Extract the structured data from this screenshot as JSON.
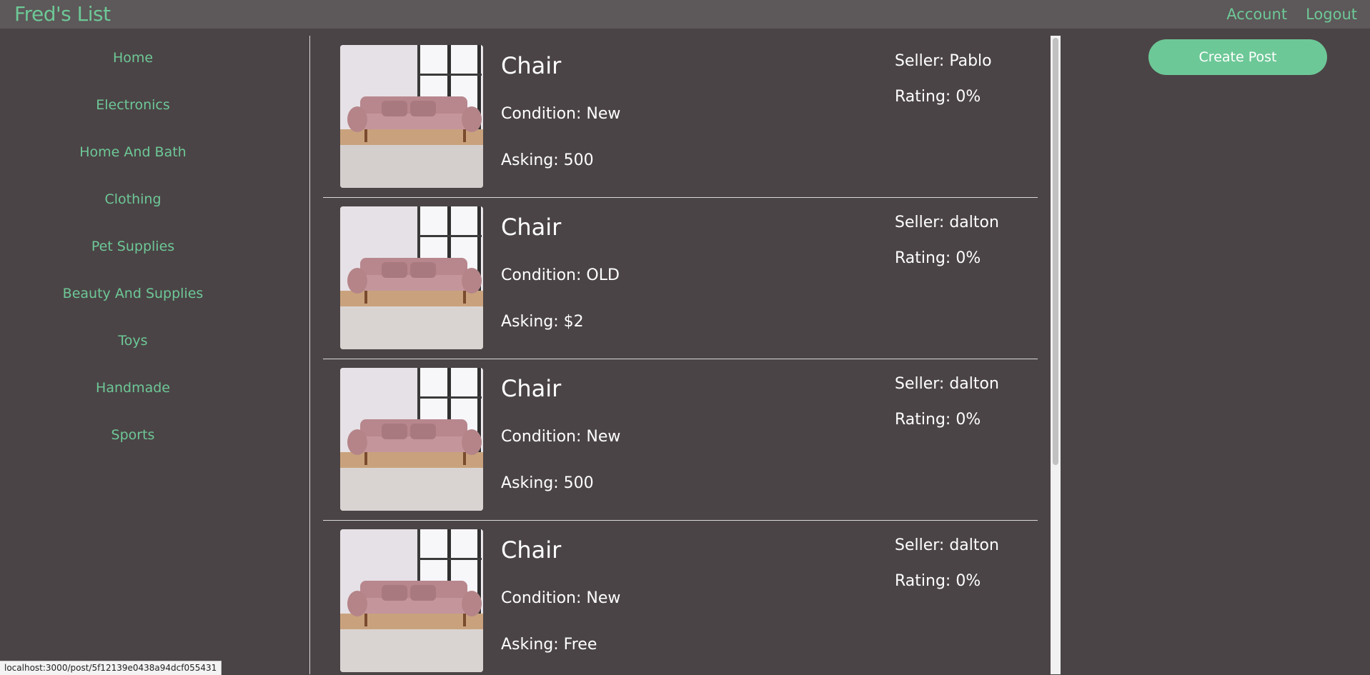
{
  "header": {
    "brand": "Fred's List",
    "nav": [
      "Account",
      "Logout"
    ]
  },
  "sidebar": {
    "items": [
      "Home",
      "Electronics",
      "Home And Bath",
      "Clothing",
      "Pet Supplies",
      "Beauty And Supplies",
      "Toys",
      "Handmade",
      "Sports"
    ]
  },
  "actions": {
    "create_post": "Create Post"
  },
  "posts": [
    {
      "title": "Chair",
      "condition": "Condition: New",
      "asking": "Asking: 500",
      "seller": "Seller: Pablo",
      "rating": "Rating: 0%"
    },
    {
      "title": "Chair",
      "condition": "Condition: OLD",
      "asking": "Asking: $2",
      "seller": "Seller: dalton",
      "rating": "Rating: 0%"
    },
    {
      "title": "Chair",
      "condition": "Condition: New",
      "asking": "Asking: 500",
      "seller": "Seller: dalton",
      "rating": "Rating: 0%"
    },
    {
      "title": "Chair",
      "condition": "Condition: New",
      "asking": "Asking: Free",
      "seller": "Seller: dalton",
      "rating": "Rating: 0%"
    }
  ],
  "status_url": "localhost:3000/post/5f12139e0438a94dcf055431",
  "colors": {
    "accent": "#6dc897",
    "background": "#4b4446",
    "topbar": "#5d5859"
  },
  "icons": {
    "post_thumbnail": "sofa-image"
  }
}
